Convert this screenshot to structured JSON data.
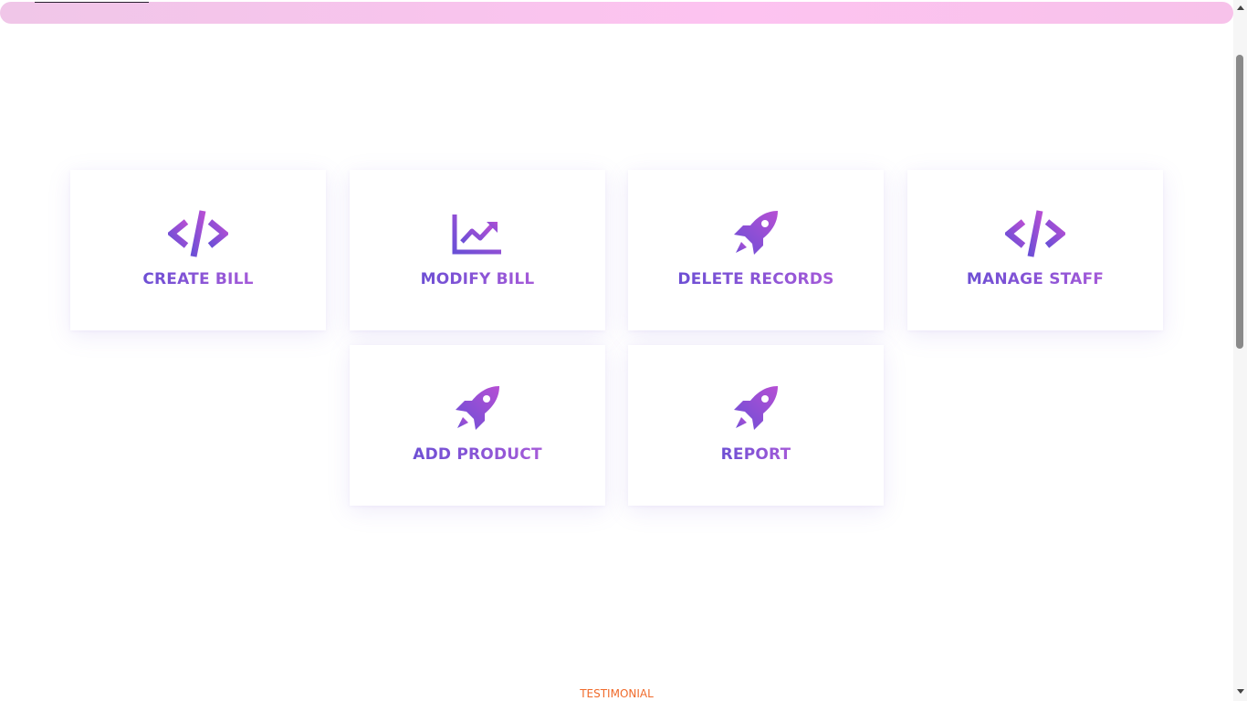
{
  "colors": {
    "icon_gradient_start": "#6a4fd6",
    "icon_gradient_end": "#b64fd4",
    "accent_orange": "#f06a2a",
    "topbar_pink": "#fdc3f0"
  },
  "cards": [
    {
      "label": "CREATE BILL",
      "icon": "code-icon"
    },
    {
      "label": "MODIFY BILL",
      "icon": "chart-line-icon"
    },
    {
      "label": "DELETE RECORDS",
      "icon": "rocket-icon"
    },
    {
      "label": "MANAGE STAFF",
      "icon": "code-icon"
    },
    {
      "label": "ADD PRODUCT",
      "icon": "rocket-icon"
    },
    {
      "label": "REPORT",
      "icon": "rocket-icon"
    }
  ],
  "footer": {
    "section_label": "TESTIMONIAL"
  }
}
